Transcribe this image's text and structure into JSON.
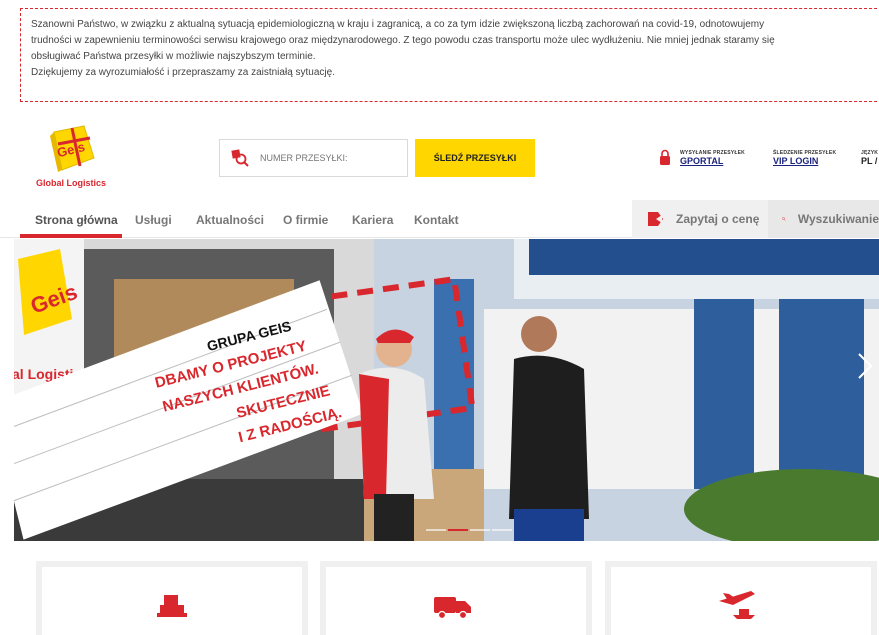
{
  "notice": {
    "lines": [
      "Szanowni Państwo, w związku z aktualną sytuacją epidemiologiczną w kraju i zagranicą, a co za tym idzie zwiększoną liczbą zachorowań na covid-19, odnotowujemy",
      "trudności w zapewnieniu terminowości serwisu krajowego oraz międzynarodowego. Z tego powodu czas transportu może ulec wydłużeniu. Nie mniej jednak staramy się",
      "obsługiwać Państwa przesyłki w możliwie najszybszym terminie.",
      "Dziękujemy za wyrozumiałość i przepraszamy za zaistniałą sytuację."
    ]
  },
  "logo": {
    "mark": "Geis",
    "name": "Global Logistics"
  },
  "tracking": {
    "placeholder": "NUMER PRZESYŁKI:",
    "button": "ŚLEDŹ PRZESYŁKI"
  },
  "utility": {
    "sending": {
      "caption": "WYSYŁANIE PRZESYŁEK",
      "link": "GPORTAL"
    },
    "tracking": {
      "caption": "ŚLEDZENIE PRZESYŁEK",
      "link": "VIP LOGIN"
    },
    "language": {
      "caption": "JĘZYK",
      "link": "PL /"
    }
  },
  "nav": {
    "items": [
      "Strona główna",
      "Usługi",
      "Aktualności",
      "O firmie",
      "Kariera",
      "Kontakt"
    ],
    "active_index": 0,
    "quote": "Zapytaj o cenę",
    "search": "Wyszukiwanie"
  },
  "hero": {
    "banner": [
      "GRUPA GEIS",
      "DBAMY O PROJEKTY",
      "NASZYCH KLIENTÓW.",
      "SKUTECZNIE",
      "I Z RADOŚCIĄ."
    ],
    "truck_logo_mark": "Geis",
    "truck_logo_text": "al Logistics",
    "slides": 4,
    "active_slide": 1
  },
  "colors": {
    "brand_red": "#d9272e",
    "brand_yellow": "#ffd600",
    "link_blue": "#1a237e"
  },
  "cards": [
    {
      "icon": "warehouse-pallet-icon"
    },
    {
      "icon": "delivery-truck-icon"
    },
    {
      "icon": "plane-ship-icon"
    }
  ]
}
